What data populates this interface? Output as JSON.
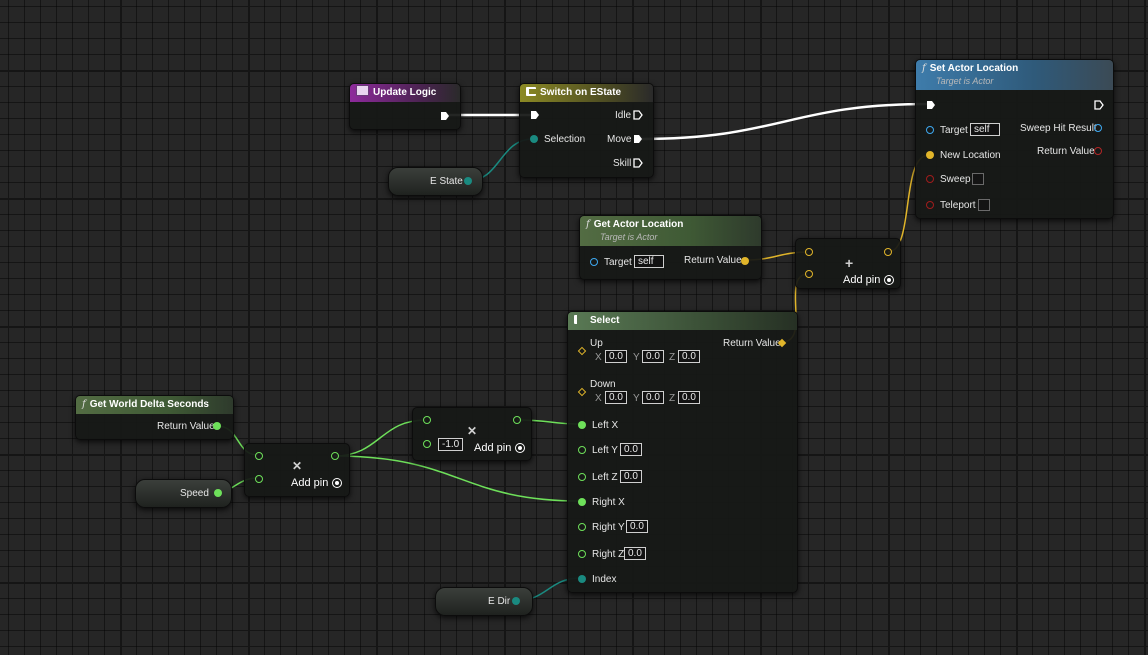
{
  "colors": {
    "exec": "#ffffff",
    "float": "#6ee05a",
    "vector": "#e1b52a",
    "enum": "#1a8a80",
    "object": "#3ea8f0",
    "bool": "#a01c1c",
    "struct_red": "#b22626"
  },
  "update_logic": {
    "title": "Update Logic",
    "icon": "event-icon"
  },
  "switch": {
    "title": "Switch on EState",
    "selection": "Selection",
    "idle": "Idle",
    "move": "Move",
    "skill": "Skill",
    "icon": "switch-icon"
  },
  "estate": {
    "label": "E State"
  },
  "set_actor": {
    "title": "Set Actor Location",
    "subtitle": "Target is Actor",
    "target": "Target",
    "target_value": "self",
    "new_location": "New Location",
    "sweep": "Sweep",
    "teleport": "Teleport",
    "sweep_hit": "Sweep Hit Result",
    "return_value": "Return Value",
    "icon": "function-icon"
  },
  "get_actor": {
    "title": "Get Actor Location",
    "subtitle": "Target is Actor",
    "target": "Target",
    "target_value": "self",
    "return_value": "Return Value",
    "icon": "function-icon"
  },
  "add_vec": {
    "add_pin": "Add pin"
  },
  "select": {
    "title": "Select",
    "return_value": "Return Value",
    "up": "Up",
    "down": "Down",
    "up_x": "0.0",
    "up_y": "0.0",
    "up_z": "0.0",
    "down_x": "0.0",
    "down_y": "0.0",
    "down_z": "0.0",
    "left_x": "Left X",
    "left_y": "Left Y",
    "left_z": "Left Z",
    "right_x": "Right X",
    "right_y": "Right Y",
    "right_z": "Right Z",
    "left_y_val": "0.0",
    "left_z_val": "0.0",
    "right_y_val": "0.0",
    "right_z_val": "0.0",
    "index": "Index",
    "axis_x": "X",
    "axis_y": "Y",
    "axis_z": "Z",
    "icon": "select-icon"
  },
  "get_delta": {
    "title": "Get World Delta Seconds",
    "return_value": "Return Value",
    "icon": "function-icon"
  },
  "speed": {
    "label": "Speed"
  },
  "mult1": {
    "add_pin": "Add pin"
  },
  "mult2": {
    "const": "-1.0",
    "add_pin": "Add pin"
  },
  "edir": {
    "label": "E Dir"
  }
}
